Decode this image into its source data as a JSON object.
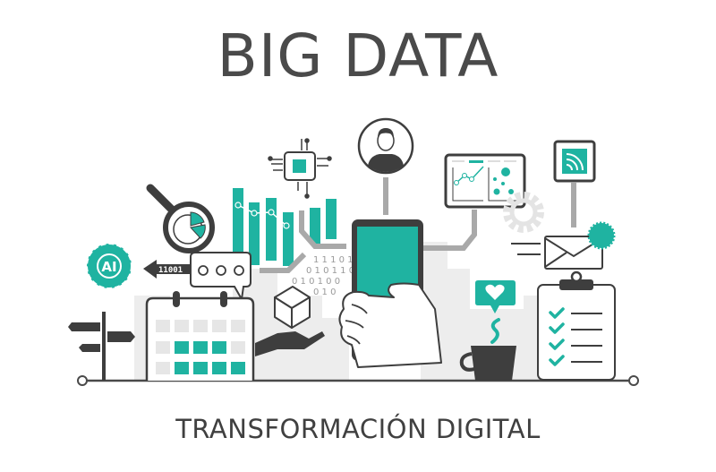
{
  "title": "BIG DATA",
  "subtitle": "TRANSFORMACIÓN DIGITAL",
  "illustration": {
    "ai_badge_label": "AI",
    "binary_arrow_label": "11001",
    "binary_stream": [
      "1 1  1 0 1",
      "0 1 0 1 1 0",
      "0 1 0 1 0 0",
      "0 1 0"
    ]
  },
  "colors": {
    "teal": "#1fb3a1",
    "dark": "#3e3e3e",
    "gray": "#a9a9a9",
    "light": "#ececec",
    "text": "#4a4a4a"
  }
}
